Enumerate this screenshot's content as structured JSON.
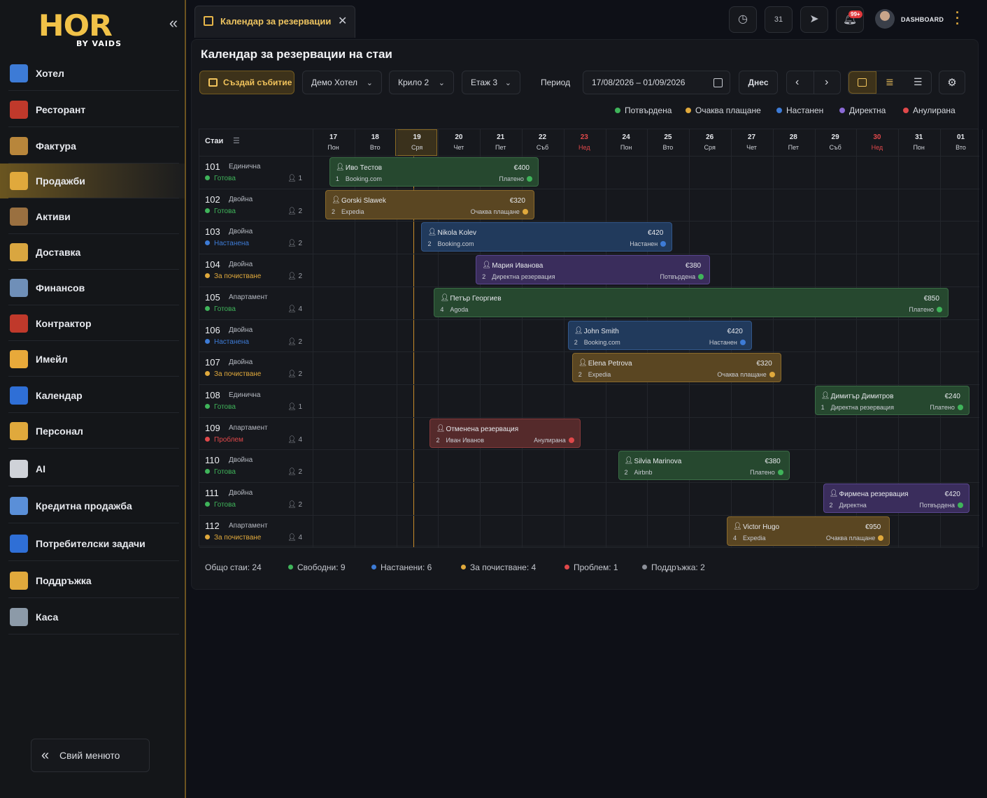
{
  "brand": {
    "logo_main": "HOR",
    "logo_sub": "BY VAIDS"
  },
  "sidebar": {
    "items": [
      {
        "label": "Хотел",
        "icon": "hotel-icon",
        "color": "#3d7bd6"
      },
      {
        "label": "Ресторант",
        "icon": "restaurant-icon",
        "color": "#c0392b"
      },
      {
        "label": "Фактура",
        "icon": "invoice-icon",
        "color": "#b8863b"
      },
      {
        "label": "Продажби",
        "icon": "money-bag-icon",
        "color": "#e0a93c",
        "active": true
      },
      {
        "label": "Активи",
        "icon": "assets-box-icon",
        "color": "#9a7040"
      },
      {
        "label": "Доставка",
        "icon": "delivery-truck-icon",
        "color": "#d9a640"
      },
      {
        "label": "Финансов",
        "icon": "finance-printer-icon",
        "color": "#6f8fb8"
      },
      {
        "label": "Контрактор",
        "icon": "contractor-icon",
        "color": "#c0392b"
      },
      {
        "label": "Имейл",
        "icon": "email-icon",
        "color": "#e8a93a"
      },
      {
        "label": "Календар",
        "icon": "calendar-icon",
        "color": "#2f6fd6"
      },
      {
        "label": "Персонал",
        "icon": "staff-icon",
        "color": "#e0a93c"
      },
      {
        "label": "AI",
        "icon": "ai-icon",
        "color": "#cfd2d8"
      },
      {
        "label": "Кредитна продажба",
        "icon": "atom-icon",
        "color": "#5a8fd8"
      },
      {
        "label": "Потребителски задачи",
        "icon": "tasks-calendar-icon",
        "color": "#2f6fd6"
      },
      {
        "label": "Поддръжка",
        "icon": "support-24-icon",
        "color": "#e0a93c"
      },
      {
        "label": "Каса",
        "icon": "cashbox-icon",
        "color": "#8c9aa8"
      }
    ],
    "hide_menu_label": "Свий менюто"
  },
  "topbar": {
    "tab_label": "Календар за резервации",
    "notif_badge": "99+",
    "user_label": "DASHBOARD"
  },
  "page": {
    "title": "Календар за резервации на стаи",
    "create_button": "Създай събитие",
    "filters": {
      "hotel": "Демо Хотел",
      "wing": "Крило 2",
      "floor": "Етаж 3"
    },
    "period_label": "Период",
    "period_value": "17/08/2026 – 01/09/2026",
    "today_button": "Днес"
  },
  "legend": [
    {
      "label": "Потвърдена",
      "color": "#3fb45a"
    },
    {
      "label": "Очаква плащане",
      "color": "#e0a93c"
    },
    {
      "label": "Настанен",
      "color": "#3d7bd6"
    },
    {
      "label": "Директна",
      "color": "#8b6ad6"
    },
    {
      "label": "Анулирана",
      "color": "#e0484a"
    }
  ],
  "grid": {
    "rooms_header": "Стаи",
    "days": [
      {
        "d": "17",
        "w": "Пон"
      },
      {
        "d": "18",
        "w": "Вто"
      },
      {
        "d": "19",
        "w": "Сря",
        "today": true
      },
      {
        "d": "20",
        "w": "Чет"
      },
      {
        "d": "21",
        "w": "Пет"
      },
      {
        "d": "22",
        "w": "Съб"
      },
      {
        "d": "23",
        "w": "Нед",
        "weekend": true
      },
      {
        "d": "24",
        "w": "Пон"
      },
      {
        "d": "25",
        "w": "Вто"
      },
      {
        "d": "26",
        "w": "Сря"
      },
      {
        "d": "27",
        "w": "Чет"
      },
      {
        "d": "28",
        "w": "Пет"
      },
      {
        "d": "29",
        "w": "Съб"
      },
      {
        "d": "30",
        "w": "Нед",
        "weekend": true
      },
      {
        "d": "31",
        "w": "Пон"
      },
      {
        "d": "01",
        "w": "Вто"
      }
    ],
    "rooms": [
      {
        "no": "101",
        "type": "Единична",
        "status": "Готова",
        "color": "#3fb45a",
        "cap": "1"
      },
      {
        "no": "102",
        "type": "Двойна",
        "status": "Готова",
        "color": "#3fb45a",
        "cap": "2"
      },
      {
        "no": "103",
        "type": "Двойна",
        "status": "Настанена",
        "color": "#3d7bd6",
        "cap": "2"
      },
      {
        "no": "104",
        "type": "Двойна",
        "status": "За почистване",
        "color": "#e0a93c",
        "cap": "2"
      },
      {
        "no": "105",
        "type": "Апартамент",
        "status": "Готова",
        "color": "#3fb45a",
        "cap": "4"
      },
      {
        "no": "106",
        "type": "Двойна",
        "status": "Настанена",
        "color": "#3d7bd6",
        "cap": "2"
      },
      {
        "no": "107",
        "type": "Двойна",
        "status": "За почистване",
        "color": "#e0a93c",
        "cap": "2"
      },
      {
        "no": "108",
        "type": "Единична",
        "status": "Готова",
        "color": "#3fb45a",
        "cap": "1"
      },
      {
        "no": "109",
        "type": "Апартамент",
        "status": "Проблем",
        "color": "#e0484a",
        "cap": "4"
      },
      {
        "no": "110",
        "type": "Двойна",
        "status": "Готова",
        "color": "#3fb45a",
        "cap": "2"
      },
      {
        "no": "111",
        "type": "Двойна",
        "status": "Готова",
        "color": "#3fb45a",
        "cap": "2"
      },
      {
        "no": "112",
        "type": "Апартамент",
        "status": "За почистване",
        "color": "#e0a93c",
        "cap": "4"
      }
    ]
  },
  "bookings": [
    {
      "row": 0,
      "start": 0.4,
      "end": 5.4,
      "guest": "Иво Тестов",
      "guests": "1",
      "source": "Booking.com",
      "price": "€400",
      "status": "Платено",
      "style": "green",
      "dot": "#3fb45a"
    },
    {
      "row": 1,
      "start": 0.3,
      "end": 5.3,
      "guest": "Gorski Slawek",
      "guests": "2",
      "source": "Expedia",
      "price": "€320",
      "status": "Очаква плащане",
      "style": "yellow",
      "dot": "#e0a93c"
    },
    {
      "row": 2,
      "start": 2.6,
      "end": 8.6,
      "guest": "Nikola Kolev",
      "guests": "2",
      "source": "Booking.com",
      "price": "€420",
      "status": "Настанен",
      "style": "blue",
      "dot": "#3d7bd6"
    },
    {
      "row": 3,
      "start": 3.9,
      "end": 9.5,
      "guest": "Мария Иванова",
      "guests": "2",
      "source": "Директна резервация",
      "price": "€380",
      "status": "Потвърдена",
      "style": "purple",
      "dot": "#3fb45a"
    },
    {
      "row": 4,
      "start": 2.9,
      "end": 15.2,
      "guest": "Петър Георгиев",
      "guests": "4",
      "source": "Agoda",
      "price": "€850",
      "status": "Платено",
      "style": "green",
      "dot": "#3fb45a"
    },
    {
      "row": 5,
      "start": 6.1,
      "end": 10.5,
      "guest": "John Smith",
      "guests": "2",
      "source": "Booking.com",
      "price": "€420",
      "status": "Настанен",
      "style": "blue",
      "dot": "#3d7bd6"
    },
    {
      "row": 6,
      "start": 6.2,
      "end": 11.2,
      "guest": "Elena Petrova",
      "guests": "2",
      "source": "Expedia",
      "price": "€320",
      "status": "Очаква плащане",
      "style": "yellow",
      "dot": "#e0a93c"
    },
    {
      "row": 7,
      "start": 12.0,
      "end": 15.7,
      "guest": "Димитър Димитров",
      "guests": "1",
      "source": "Директна резервация",
      "price": "€240",
      "status": "Платено",
      "style": "green",
      "dot": "#3fb45a"
    },
    {
      "row": 8,
      "start": 2.8,
      "end": 6.4,
      "guest": "Отменена резервация",
      "guests": "2",
      "source": "Иван Иванов",
      "price": "",
      "status": "Анулирана",
      "style": "red",
      "dot": "#e0484a"
    },
    {
      "row": 9,
      "start": 7.3,
      "end": 11.4,
      "guest": "Silvia Marinova",
      "guests": "2",
      "source": "Airbnb",
      "price": "€380",
      "status": "Платено",
      "style": "green",
      "dot": "#3fb45a"
    },
    {
      "row": 10,
      "start": 12.2,
      "end": 15.7,
      "guest": "Фирмена резервация",
      "guests": "2",
      "source": "Директна",
      "price": "€420",
      "status": "Потвърдена",
      "style": "purple",
      "dot": "#3fb45a"
    },
    {
      "row": 11,
      "start": 9.9,
      "end": 13.8,
      "guest": "Victor Hugo",
      "guests": "4",
      "source": "Expedia",
      "price": "€950",
      "status": "Очаква плащане",
      "style": "yellow",
      "dot": "#e0a93c"
    }
  ],
  "summary": [
    {
      "label": "Общо стаи: 24",
      "color": ""
    },
    {
      "label": "Свободни: 9",
      "color": "#3fb45a"
    },
    {
      "label": "Настанени: 6",
      "color": "#3d7bd6"
    },
    {
      "label": "За почистване: 4",
      "color": "#e0a93c"
    },
    {
      "label": "Проблем: 1",
      "color": "#e0484a"
    },
    {
      "label": "Поддръжка: 2",
      "color": "#8c9099"
    }
  ]
}
